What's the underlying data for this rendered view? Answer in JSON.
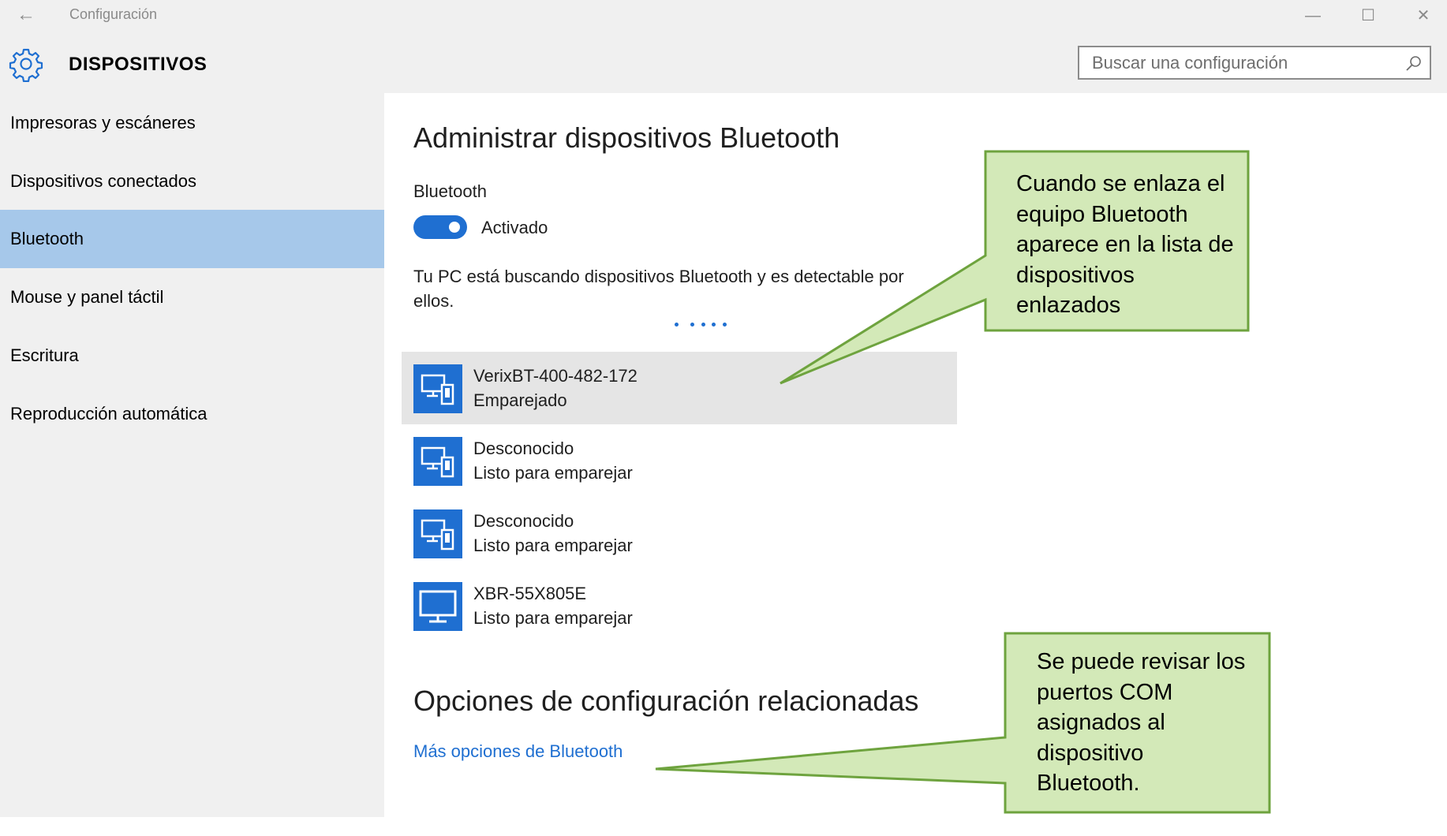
{
  "window": {
    "title": "Configuración",
    "back_icon": "back-arrow-icon",
    "controls": [
      "minimize-icon",
      "maximize-icon",
      "close-icon"
    ]
  },
  "header": {
    "icon": "gear-icon",
    "title": "DISPOSITIVOS",
    "search_placeholder": "Buscar una configuración",
    "search_icon": "search-icon"
  },
  "sidebar": {
    "items": [
      {
        "label": "Impresoras y escáneres"
      },
      {
        "label": "Dispositivos conectados"
      },
      {
        "label": "Bluetooth",
        "active": true
      },
      {
        "label": "Mouse y panel táctil"
      },
      {
        "label": "Escritura"
      },
      {
        "label": "Reproducción automática"
      }
    ]
  },
  "main": {
    "title": "Administrar dispositivos Bluetooth",
    "bluetooth_label": "Bluetooth",
    "toggle_state": "Activado",
    "toggle_on": true,
    "scan_text": "Tu PC está buscando dispositivos Bluetooth y es detectable por ellos.",
    "devices": [
      {
        "name": "VerixBT-400-482-172",
        "status": "Emparejado",
        "icon": "phone-pc-device-icon",
        "selected": true
      },
      {
        "name": "Desconocido",
        "status": "Listo para emparejar",
        "icon": "phone-pc-device-icon"
      },
      {
        "name": "Desconocido",
        "status": "Listo para emparejar",
        "icon": "phone-pc-device-icon"
      },
      {
        "name": "XBR-55X805E",
        "status": "Listo para emparejar",
        "icon": "monitor-device-icon"
      }
    ],
    "related_title": "Opciones de configuración relacionadas",
    "more_link": "Más opciones de Bluetooth"
  },
  "callouts": [
    {
      "lines": [
        "Cuando se enlaza el",
        "equipo Bluetooth",
        "aparece en la lista de",
        "dispositivos",
        "enlazados"
      ]
    },
    {
      "lines": [
        "Se puede revisar los",
        "puertos COM",
        "asignados al",
        "dispositivo",
        "Bluetooth."
      ]
    }
  ],
  "colors": {
    "accent": "#1f6fd1",
    "sidebar_bg": "#f0f0f0",
    "sidebar_active": "#a6c8ea",
    "selected_row": "#e5e5e5",
    "callout_fill": "#d3e9b8",
    "callout_border": "#6ea33e"
  }
}
